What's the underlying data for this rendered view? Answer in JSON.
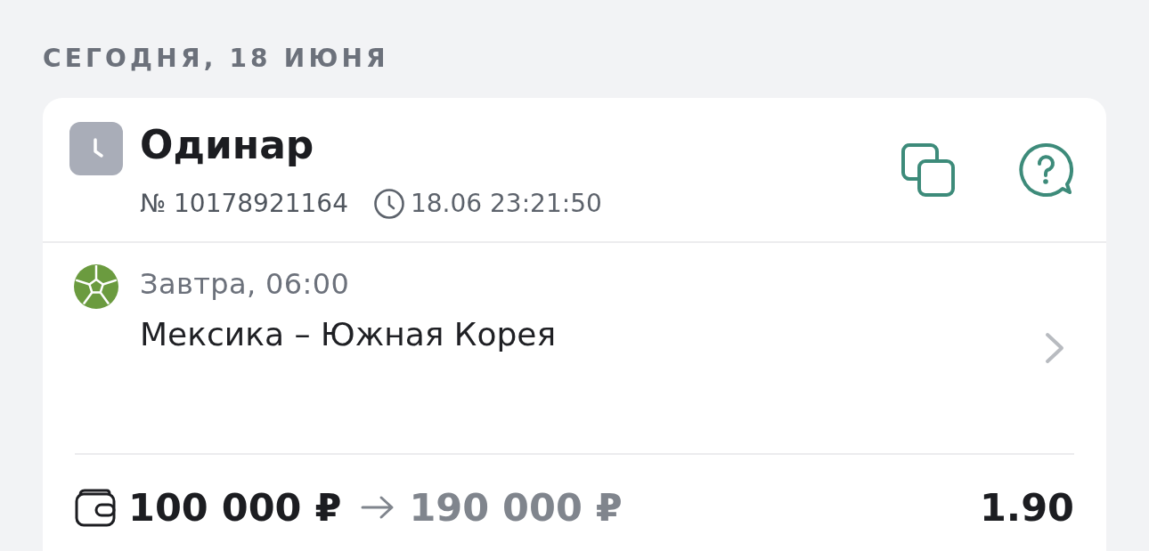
{
  "date_header": "СЕГОДНЯ, 18 ИЮНЯ",
  "bet": {
    "type": "Одинар",
    "number": "№ 10178921164",
    "placed_at": "18.06 23:21:50",
    "events": [
      {
        "time": "Завтра, 06:00",
        "match": "Мексика – Южная Корея"
      }
    ],
    "stake": "100 000 ₽",
    "payout": "190 000 ₽",
    "odds": "1.90"
  }
}
